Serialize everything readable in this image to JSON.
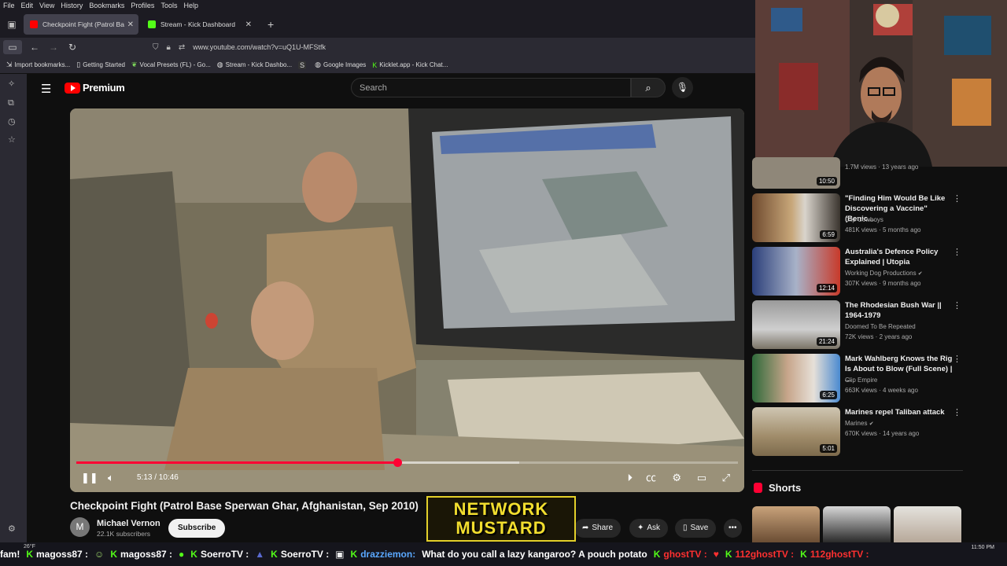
{
  "browser": {
    "menu": [
      "File",
      "Edit",
      "View",
      "History",
      "Bookmarks",
      "Profiles",
      "Tools",
      "Help"
    ],
    "tabs": [
      {
        "label": "Checkpoint Fight (Patrol Ba",
        "favicon_color": "#ff0000",
        "active": true
      },
      {
        "label": "Stream - Kick Dashboard",
        "favicon_color": "#53fc18",
        "active": false
      }
    ],
    "url": "www.youtube.com/watch?v=uQ1U-MFStfk",
    "bookmarks": [
      {
        "icon": "import-icon",
        "label": "Import bookmarks..."
      },
      {
        "icon": "page-icon",
        "label": "Getting Started"
      },
      {
        "icon": "leaf-icon",
        "label": "Vocal Presets (FL) - Go..."
      },
      {
        "icon": "globe-icon",
        "label": "Stream - Kick Dashbo..."
      },
      {
        "icon": "s-icon",
        "label": ""
      },
      {
        "icon": "globe-icon",
        "label": "Google Images"
      },
      {
        "icon": "kick-icon",
        "label": "Kicklet.app - Kick Chat..."
      }
    ]
  },
  "youtube": {
    "logo_text": "Premium",
    "search_placeholder": "Search",
    "player": {
      "current_time": "5:13",
      "duration": "10:46",
      "time_display": "5:13 / 10:46",
      "progress_fraction": 0.485
    },
    "video_title": "Checkpoint Fight (Patrol Base Sperwan Ghar, Afghanistan, Sep 2010)",
    "channel": {
      "avatar_letter": "M",
      "name": "Michael Vernon",
      "subscribers": "22.1K subscribers"
    },
    "subscribe_label": "Subscribe",
    "actions": {
      "share": "Share",
      "ask": "Ask",
      "save": "Save"
    }
  },
  "recommendations": [
    {
      "title": "",
      "channel": "",
      "meta": "1.7M views · 13 years ago",
      "duration": "10:50",
      "verified": false
    },
    {
      "title": "\"Finding Him Would Be Like Discovering a Vaccine\" (Benic...",
      "channel": "Clip Cowboys",
      "meta": "481K views · 5 months ago",
      "duration": "6:59",
      "verified": false
    },
    {
      "title": "Australia's Defence Policy Explained | Utopia",
      "channel": "Working Dog Productions",
      "meta": "307K views · 9 months ago",
      "duration": "12:14",
      "verified": true
    },
    {
      "title": "The Rhodesian Bush War || 1964-1979",
      "channel": "Doomed To Be Repeated",
      "meta": "72K views · 2 years ago",
      "duration": "21:24",
      "verified": false
    },
    {
      "title": "Mark Wahlberg Knows the Rig Is About to Blow (Full Scene) | ...",
      "channel": "Clip Empire",
      "meta": "663K views · 4 weeks ago",
      "duration": "6:25",
      "verified": false
    },
    {
      "title": "Marines repel Taliban attack",
      "channel": "Marines",
      "meta": "670K views · 14 years ago",
      "duration": "5:01",
      "verified": true
    }
  ],
  "shorts_label": "Shorts",
  "overlay": {
    "logo_line1": "NETWORK",
    "logo_line2": "MUSTARD"
  },
  "ticker": [
    {
      "user": "fam!",
      "style": "msg"
    },
    {
      "user": "magoss87 :",
      "style": "kick"
    },
    {
      "user": "magoss87 :",
      "style": "kick"
    },
    {
      "user": "SoerroTV :",
      "style": "kick"
    },
    {
      "user": "SoerroTV :",
      "style": "kick"
    },
    {
      "user": "drazziemon:",
      "style": "blue"
    },
    {
      "user": "What do you call a lazy kangaroo? A pouch potato",
      "style": "msg"
    },
    {
      "user": "ghostTV :",
      "style": "red"
    },
    {
      "user": "112ghostTV :",
      "style": "red"
    },
    {
      "user": "112ghostTV :",
      "style": "red"
    }
  ],
  "system": {
    "weather": "26°F",
    "clock": "11:50 PM"
  }
}
